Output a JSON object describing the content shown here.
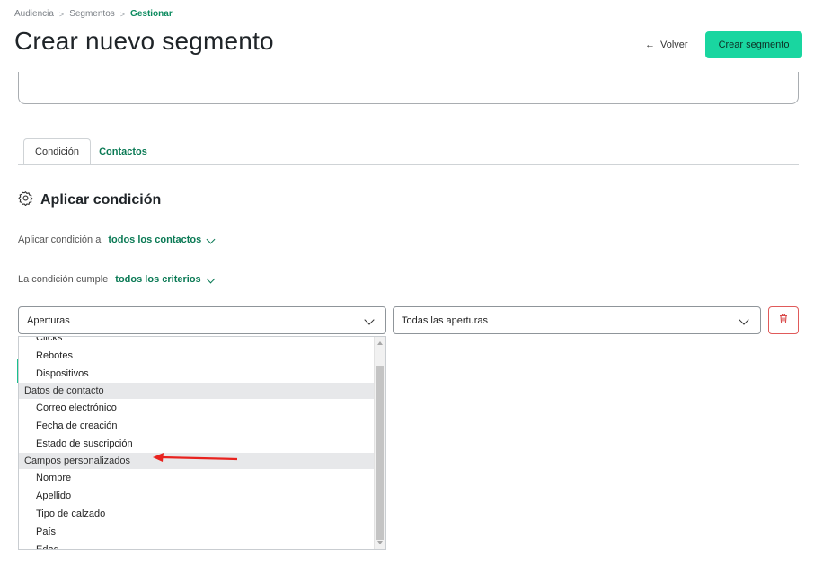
{
  "breadcrumb": {
    "items": [
      "Audiencia",
      "Segmentos",
      "Gestionar"
    ]
  },
  "header": {
    "title": "Crear nuevo segmento",
    "back_label": "Volver",
    "create_label": "Crear segmento"
  },
  "tabs": [
    {
      "label": "Condición"
    },
    {
      "label": "Contactos"
    }
  ],
  "section": {
    "title": "Aplicar condición"
  },
  "apply_condition": {
    "label": "Aplicar condición a",
    "value": "todos los contactos"
  },
  "criteria": {
    "label": "La condición cumple",
    "value": "todos los criterios"
  },
  "condition_row": {
    "field_select": "Aperturas",
    "value_select": "Todas las aperturas"
  },
  "dropdown": {
    "items": [
      {
        "type": "item",
        "label": "Clicks"
      },
      {
        "type": "item",
        "label": "Rebotes"
      },
      {
        "type": "item",
        "label": "Dispositivos"
      },
      {
        "type": "group",
        "label": "Datos de contacto"
      },
      {
        "type": "item",
        "label": "Correo electrónico"
      },
      {
        "type": "item",
        "label": "Fecha de creación"
      },
      {
        "type": "item",
        "label": "Estado de suscripción"
      },
      {
        "type": "group",
        "label": "Campos personalizados"
      },
      {
        "type": "item",
        "label": "Nombre"
      },
      {
        "type": "item",
        "label": "Apellido"
      },
      {
        "type": "item",
        "label": "Tipo de calzado"
      },
      {
        "type": "item",
        "label": "País"
      },
      {
        "type": "item",
        "label": "Edad"
      }
    ]
  },
  "colors": {
    "accent": "#19d6a0",
    "link": "#0b7a55",
    "danger": "#e05a5a",
    "annotation_arrow": "#e8231f"
  }
}
